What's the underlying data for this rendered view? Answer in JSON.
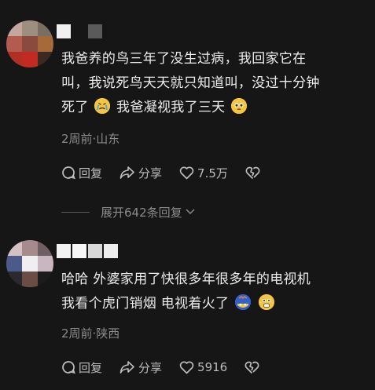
{
  "comments": [
    {
      "text_line1": "我爸养的鸟三年了没生过病，我回家它在",
      "text_line2": "叫，我说死鸟天天就只知道叫，没过十分钟",
      "text_line3_a": "死了",
      "text_line3_b": "我爸凝视我了三天",
      "emoji_1": "crying-face",
      "emoji_2": "pleading-face",
      "meta": "2周前·山东",
      "reply_label": "回复",
      "share_label": "分享",
      "like_count": "7.5万"
    },
    {
      "text_line1": "哈哈 外婆家用了快很多年很多年的电视机",
      "text_line2_a": "我看个虎门销烟 电视着火了",
      "emoji_1": "exploding-head",
      "emoji_2": "fearful-face",
      "meta": "2周前·陕西",
      "reply_label": "回复",
      "share_label": "分享",
      "like_count": "5916"
    }
  ],
  "expand_replies": "展开642条回复",
  "colors": {
    "background": "#161616",
    "text": "#ededed",
    "meta": "#8b8b8b",
    "icon": "#bdbdbd"
  }
}
